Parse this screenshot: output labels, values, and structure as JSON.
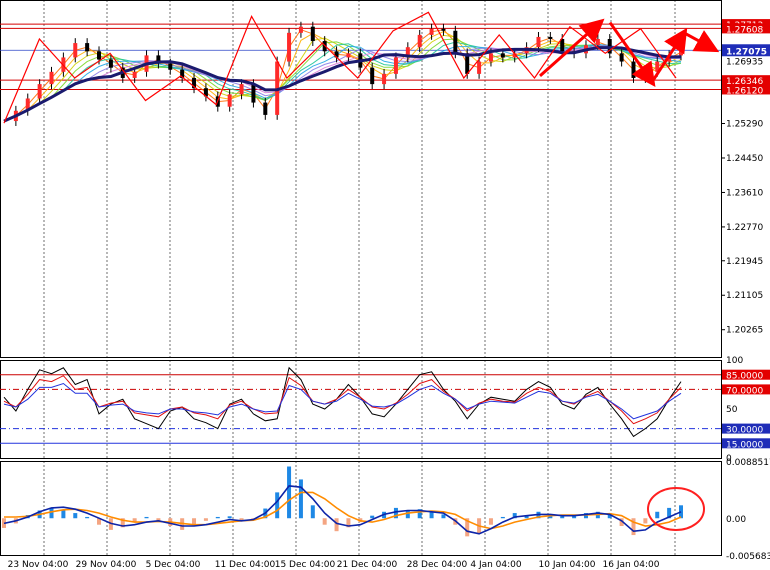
{
  "colors": {
    "background": "#ffffff",
    "grid": "#000000",
    "frame": "#000000",
    "zigzag": "#ff0000",
    "level_line": "#d40000",
    "current_price_line": "#2a44c8",
    "current_price_label_bg": "#1f2db8",
    "ma_slow": "#1a1a6e",
    "rainbow": [
      "#ff6a00",
      "#ffb000",
      "#cfd000",
      "#7cd82c",
      "#22c79a",
      "#24a7e6",
      "#8a7ee8",
      "#d87ad8"
    ],
    "candle": "#000000",
    "candle_up_marker": "#ff2a2a",
    "rsi_black": "#000000",
    "rsi_red": "#e01010",
    "rsi_blue": "#2233dd",
    "osc_hist_pos": "#1e88e5",
    "osc_hist_neg": "#f4a582",
    "osc_fast": "#0d24a8",
    "osc_slow": "#ff8c00",
    "highlight_circle": "#ff2020"
  },
  "chart_data": [
    {
      "type": "line",
      "panel": "price",
      "ylim": [
        1.196,
        1.283
      ],
      "y_tick_labels": [
        "1.25290",
        "1.24450",
        "1.23610",
        "1.22770",
        "1.21945",
        "1.21105",
        "1.20265"
      ],
      "y_tick_values": [
        1.2529,
        1.2445,
        1.2361,
        1.2277,
        1.21945,
        1.21105,
        1.20265
      ],
      "levels": [
        {
          "label": "1.27713",
          "value": 1.27713,
          "kind": "resistance"
        },
        {
          "label": "1.27608",
          "value": 1.27608,
          "kind": "resistance"
        },
        {
          "label": "1.26346",
          "value": 1.26346,
          "kind": "support"
        },
        {
          "label": "1.26120",
          "value": 1.2612,
          "kind": "support"
        }
      ],
      "current_price": {
        "label": "1.27075",
        "value": 1.27075
      },
      "secondary_price_label": "1.26935",
      "x_time_labels": [
        "23 Nov 04:00",
        "29 Nov 04:00",
        "5 Dec 04:00",
        "11 Dec 04:00",
        "15 Dec 04:00",
        "21 Dec 04:00",
        "28 Dec 04:00",
        "4 Jan 04:00",
        "10 Jan 04:00",
        "16 Jan 04:00"
      ],
      "close_series": [
        1.2535,
        1.256,
        1.259,
        1.2625,
        1.2655,
        1.269,
        1.2725,
        1.2705,
        1.2685,
        1.2665,
        1.264,
        1.2655,
        1.2695,
        1.2675,
        1.266,
        1.264,
        1.2615,
        1.2595,
        1.257,
        1.26,
        1.2625,
        1.258,
        1.255,
        1.268,
        1.275,
        1.2765,
        1.273,
        1.2705,
        1.269,
        1.27,
        1.2665,
        1.2625,
        1.265,
        1.269,
        1.2715,
        1.2745,
        1.276,
        1.2755,
        1.27,
        1.265,
        1.268,
        1.27,
        1.269,
        1.27,
        1.2715,
        1.274,
        1.2735,
        1.2705,
        1.27,
        1.272,
        1.2735,
        1.27,
        1.268,
        1.264,
        1.2655,
        1.268,
        1.2695,
        1.271
      ],
      "zigzag": [
        1.253,
        1.2735,
        1.264,
        1.27,
        1.2585,
        1.2645,
        1.2575,
        1.279,
        1.264,
        1.2725,
        1.264,
        1.2755,
        1.28,
        1.264,
        1.2745,
        1.264,
        1.2765,
        1.27,
        1.276,
        1.264
      ],
      "forecast_arrows": [
        {
          "from": 1.2645,
          "to": 1.2775
        },
        {
          "from": 1.2775,
          "to": 1.263
        },
        {
          "from": 1.263,
          "to": 1.275
        },
        {
          "from": 1.275,
          "to": 1.271
        }
      ]
    },
    {
      "type": "line",
      "panel": "rsi",
      "ylim": [
        0,
        100
      ],
      "y_tick_labels": [
        "100",
        "50",
        "0"
      ],
      "levels": [
        {
          "label": "85.0000",
          "value": 85,
          "style": "solid"
        },
        {
          "label": "70.0000",
          "value": 70,
          "style": "dashdot"
        },
        {
          "label": "30.0000",
          "value": 30,
          "style": "dashdot"
        },
        {
          "label": "15.0000",
          "value": 15,
          "style": "solid"
        }
      ],
      "series": [
        {
          "values": [
            62,
            48,
            70,
            90,
            86,
            92,
            75,
            80,
            45,
            55,
            60,
            40,
            35,
            30,
            48,
            52,
            40,
            36,
            30,
            55,
            60,
            45,
            38,
            40,
            92,
            80,
            55,
            50,
            60,
            75,
            62,
            45,
            42,
            55,
            70,
            85,
            88,
            70,
            58,
            40,
            55,
            62,
            60,
            58,
            70,
            78,
            72,
            55,
            50,
            65,
            72,
            55,
            40,
            22,
            30,
            40,
            60,
            78
          ]
        },
        {
          "values": [
            58,
            52,
            65,
            80,
            78,
            84,
            70,
            72,
            52,
            56,
            58,
            46,
            44,
            42,
            50,
            52,
            46,
            44,
            40,
            54,
            58,
            50,
            45,
            46,
            82,
            74,
            58,
            55,
            60,
            70,
            62,
            52,
            50,
            56,
            65,
            76,
            80,
            68,
            60,
            48,
            56,
            60,
            58,
            57,
            66,
            72,
            68,
            58,
            55,
            63,
            68,
            58,
            48,
            35,
            40,
            46,
            60,
            72
          ]
        },
        {
          "values": [
            55,
            52,
            60,
            72,
            72,
            76,
            66,
            66,
            52,
            54,
            55,
            48,
            46,
            45,
            50,
            50,
            47,
            46,
            44,
            52,
            55,
            50,
            47,
            48,
            74,
            70,
            58,
            55,
            58,
            66,
            60,
            53,
            52,
            55,
            62,
            70,
            74,
            66,
            60,
            50,
            55,
            58,
            57,
            56,
            62,
            68,
            66,
            58,
            56,
            62,
            65,
            58,
            50,
            40,
            44,
            48,
            58,
            66
          ]
        }
      ]
    },
    {
      "type": "bar",
      "panel": "oscillator",
      "ylim": [
        -0.005683,
        0.008851
      ],
      "y_tick_labels": [
        "0.0088517",
        "0.00",
        "-0.005683"
      ],
      "histogram": [
        -0.0015,
        -0.0008,
        0.0005,
        0.0012,
        0.0016,
        0.0012,
        0.0008,
        0.0002,
        -0.001,
        -0.0018,
        -0.0014,
        -0.0006,
        0.0002,
        -0.0004,
        -0.0012,
        -0.0018,
        -0.001,
        -0.0004,
        0.0002,
        0.0003,
        -0.0005,
        -0.0002,
        0.0015,
        0.004,
        0.008,
        0.006,
        0.002,
        -0.001,
        -0.002,
        -0.0014,
        -0.0006,
        0.0004,
        0.001,
        0.0016,
        0.0012,
        0.0014,
        0.001,
        0.0006,
        -0.001,
        -0.0028,
        -0.0024,
        -0.001,
        0.0002,
        0.0008,
        0.0004,
        0.001,
        0.0006,
        0.0003,
        0.0004,
        0.0008,
        0.001,
        0.0006,
        -0.0012,
        -0.0026,
        -0.0008,
        0.001,
        0.0016,
        0.002
      ],
      "series": [
        {
          "values": [
            -0.0008,
            -0.0004,
            0.0002,
            0.001,
            0.0016,
            0.0017,
            0.0014,
            0.0008,
            0.0,
            -0.0008,
            -0.0012,
            -0.001,
            -0.0006,
            -0.0004,
            -0.0008,
            -0.0012,
            -0.0012,
            -0.001,
            -0.0006,
            -0.0002,
            -0.0004,
            -0.0002,
            0.0008,
            0.0026,
            0.005,
            0.0048,
            0.003,
            0.0008,
            -0.0008,
            -0.0012,
            -0.001,
            -0.0002,
            0.0006,
            0.001,
            0.0012,
            0.0012,
            0.001,
            0.0008,
            -0.0004,
            -0.002,
            -0.0024,
            -0.0016,
            -0.0006,
            0.0002,
            0.0004,
            0.0006,
            0.0006,
            0.0004,
            0.0004,
            0.0006,
            0.0008,
            0.0006,
            -0.0004,
            -0.002,
            -0.0018,
            -0.0006,
            0.0002,
            0.001
          ]
        },
        {
          "values": [
            0.0002,
            0.0002,
            0.0003,
            0.0006,
            0.001,
            0.0013,
            0.0014,
            0.0012,
            0.0008,
            0.0002,
            -0.0003,
            -0.0006,
            -0.0006,
            -0.0005,
            -0.0006,
            -0.0008,
            -0.001,
            -0.001,
            -0.0008,
            -0.0006,
            -0.0004,
            -0.0003,
            0.0002,
            0.0012,
            0.0028,
            0.004,
            0.004,
            0.003,
            0.0016,
            0.0004,
            -0.0004,
            -0.0006,
            -0.0002,
            0.0004,
            0.0008,
            0.001,
            0.0011,
            0.001,
            0.0006,
            -0.0004,
            -0.0012,
            -0.0016,
            -0.0012,
            -0.0006,
            -0.0002,
            0.0002,
            0.0004,
            0.0005,
            0.0005,
            0.0005,
            0.0006,
            0.0007,
            0.0004,
            -0.0006,
            -0.0012,
            -0.001,
            -0.0006,
            0.0002
          ]
        }
      ]
    }
  ]
}
